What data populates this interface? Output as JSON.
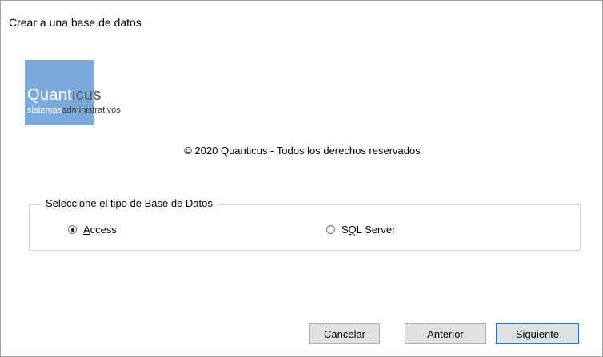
{
  "window": {
    "title": "Crear a una base de datos"
  },
  "logo": {
    "brand_highlight": "Quant",
    "brand_rest": "icus",
    "subtitle_highlight": "sistemas",
    "subtitle_rest": "administrativos",
    "accent_color": "#7ba9dc"
  },
  "copyright": "© 2020 Quanticus - Todos los derechos reservados",
  "db_type_group": {
    "legend": "Seleccione el tipo de Base de Datos",
    "options": [
      {
        "label": "Access",
        "accelerator": "A",
        "rest": "ccess",
        "selected": true
      },
      {
        "label": "SQL Server",
        "prefix": "S",
        "accelerator": "Q",
        "rest": "L Server",
        "selected": false
      }
    ]
  },
  "buttons": {
    "cancel": "Cancelar",
    "previous": "Anterior",
    "next": "Siguiente"
  }
}
